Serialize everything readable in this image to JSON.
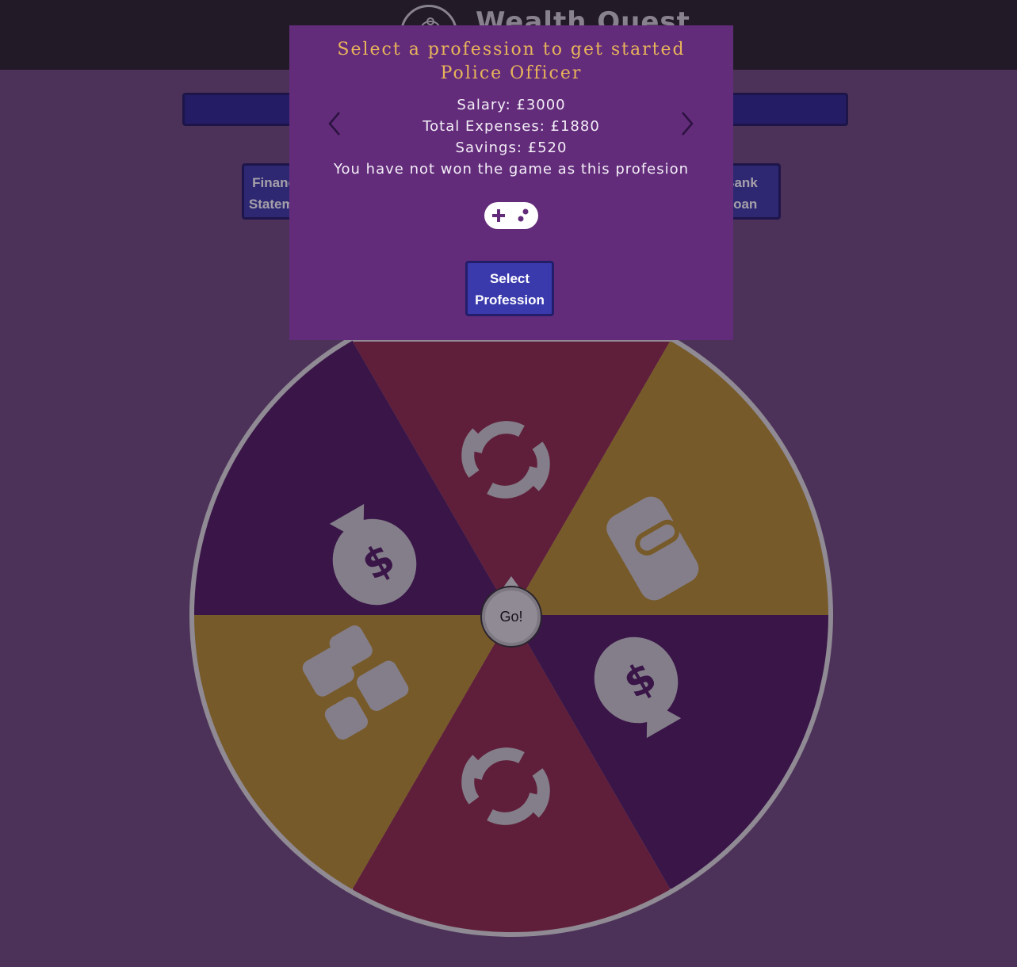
{
  "header": {
    "title": "Wealth Quest",
    "logo_icon": "piggy-bank-icon"
  },
  "buttons": {
    "left_label_line1": "Financial",
    "left_label_line2": "Statement",
    "right_label_line1": "Bank",
    "right_label_line2": "Loan"
  },
  "wheel": {
    "spin_label": "Go!",
    "segments": [
      {
        "icon": "refresh-icon",
        "color": "#8a2a46"
      },
      {
        "icon": "hand-coin-icon",
        "color": "#b28c2a"
      },
      {
        "icon": "money-bag-icon",
        "color": "#4b1a5e"
      },
      {
        "icon": "refresh-icon",
        "color": "#8a2a46"
      },
      {
        "icon": "stacked-cash-icon",
        "color": "#b28c2a"
      },
      {
        "icon": "money-bag-icon",
        "color": "#4b1a5e"
      }
    ]
  },
  "modal": {
    "title": "Select a profession to get started",
    "profession": "Police Officer",
    "salary": "Salary: £3000",
    "expenses": "Total Expenses: £1880",
    "savings": "Savings: £520",
    "status": "You have not won the game as this profesion",
    "select_line1": "Select",
    "select_line2": "Profession",
    "prev_icon": "chevron-left-icon",
    "next_icon": "chevron-right-icon",
    "game_icon": "gamepad-icon"
  },
  "colors": {
    "modal_bg": "#632c7b",
    "title_color": "#e8b45a",
    "button_bg": "#3a3aad"
  }
}
